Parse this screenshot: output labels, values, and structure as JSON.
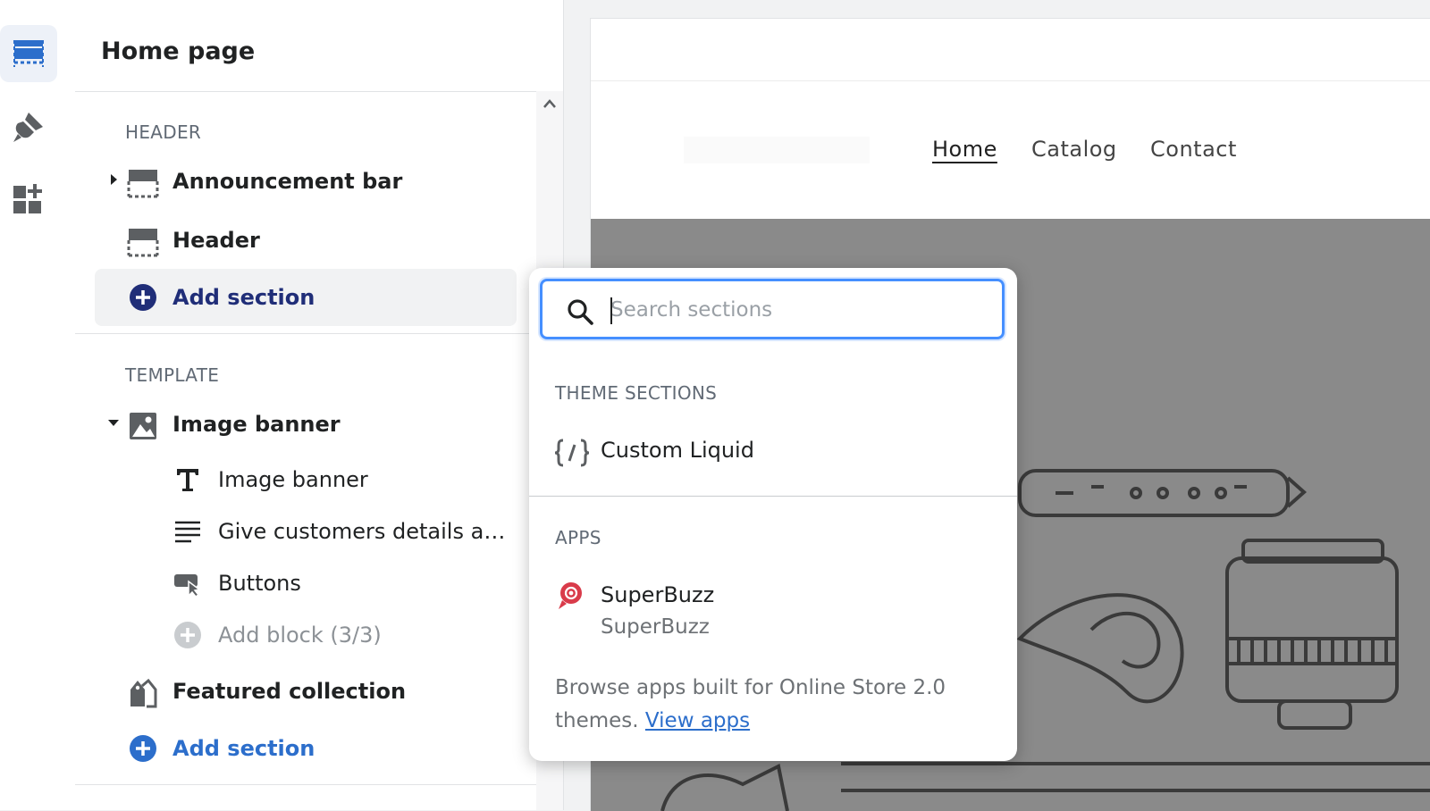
{
  "sidebar": {
    "title": "Home page",
    "header_group": "HEADER",
    "template_group": "TEMPLATE",
    "header_items": [
      {
        "label": "Announcement bar"
      },
      {
        "label": "Header"
      }
    ],
    "add_section_label": "Add section",
    "template_items": {
      "image_banner": "Image banner",
      "blocks": [
        {
          "label": "Image banner"
        },
        {
          "label": "Give customers details about the banner image(s) or content on the template."
        },
        {
          "label": "Buttons"
        },
        {
          "label": "Add block (3/3)"
        }
      ],
      "featured_collection": "Featured collection",
      "add_section_label": "Add section"
    }
  },
  "preview": {
    "nav": [
      "Home",
      "Catalog",
      "Contact"
    ]
  },
  "popup": {
    "search_placeholder": "Search sections",
    "theme_sections_label": "THEME SECTIONS",
    "theme_sections": [
      {
        "label": "Custom Liquid"
      }
    ],
    "apps_label": "APPS",
    "apps": [
      {
        "name": "SuperBuzz",
        "developer": "SuperBuzz"
      }
    ],
    "note_text": "Browse apps built for Online Store 2.0 themes.",
    "note_link": "View apps"
  }
}
